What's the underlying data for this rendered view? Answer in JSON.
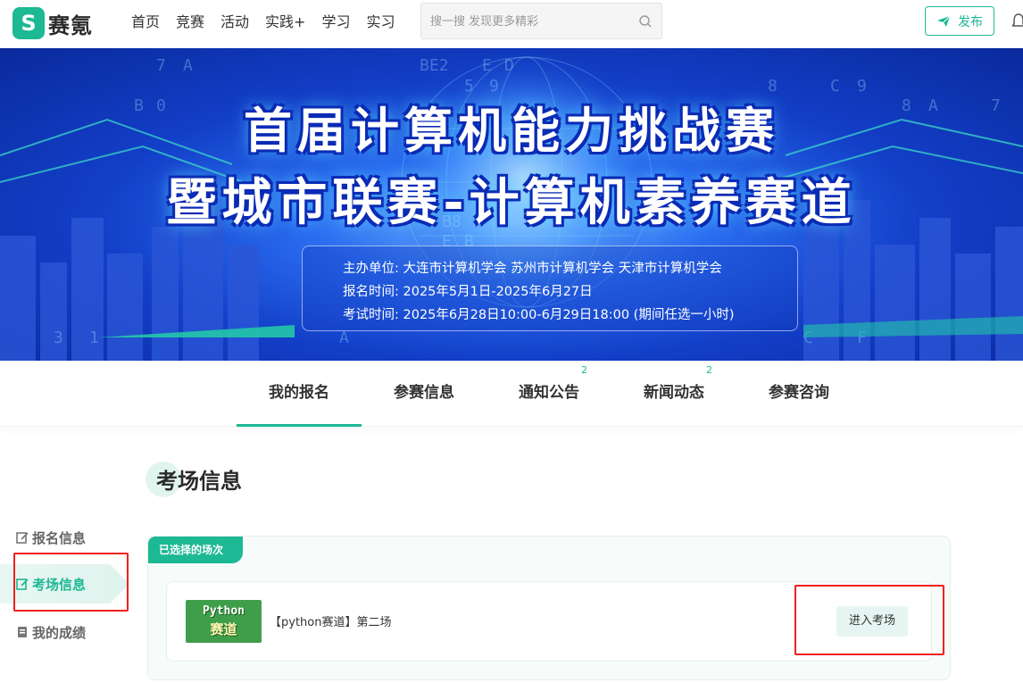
{
  "header": {
    "logo_mark": "S",
    "logo_text": "赛氪",
    "nav": [
      "首页",
      "竞赛",
      "活动",
      "实践+",
      "学习",
      "实习"
    ],
    "search_placeholder": "搜一搜 发现更多精彩",
    "publish_label": "发布",
    "accent": "#1db894"
  },
  "banner": {
    "title_line1": "首届计算机能力挑战赛",
    "title_line2": "暨城市联赛-计算机素养赛道",
    "organizer": "主办单位: 大连市计算机学会  苏州市计算机学会  天津市计算机学会",
    "registration_time": "报名时间: 2025年5月1日-2025年6月27日",
    "exam_time": "考试时间: 2025年6月28日10:00-6月29日18:00 (期间任选一小时)"
  },
  "tabs": [
    {
      "label": "我的报名",
      "badge": "",
      "active": true
    },
    {
      "label": "参赛信息",
      "badge": "",
      "active": false
    },
    {
      "label": "通知公告",
      "badge": "2",
      "active": false
    },
    {
      "label": "新闻动态",
      "badge": "2",
      "active": false
    },
    {
      "label": "参赛咨询",
      "badge": "",
      "active": false
    }
  ],
  "section_title": "考场信息",
  "side_menu": [
    {
      "label": "报名信息",
      "icon": "edit-icon",
      "active": false
    },
    {
      "label": "考场信息",
      "icon": "exam-icon",
      "active": true
    },
    {
      "label": "我的成绩",
      "icon": "score-icon",
      "active": false
    }
  ],
  "card": {
    "tag": "已选择的场次",
    "session": {
      "thumb_line1": "Python",
      "thumb_line2": "赛道",
      "name": "【python赛道】第二场",
      "enter_label": "进入考场"
    }
  }
}
